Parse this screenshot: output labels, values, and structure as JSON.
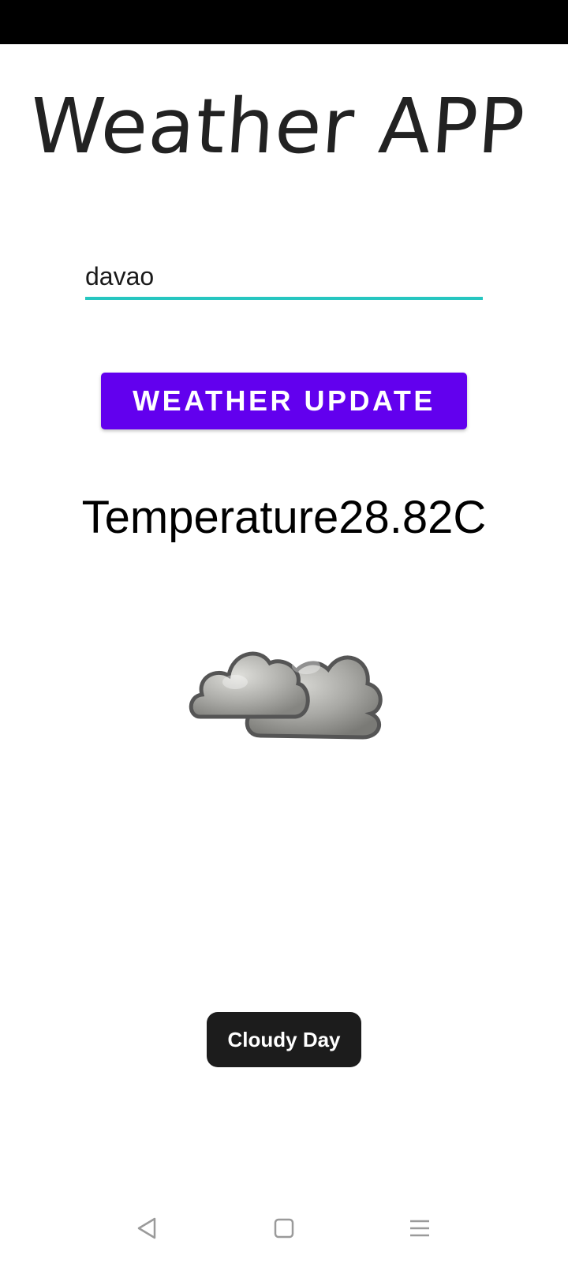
{
  "app": {
    "title": "Weather APP"
  },
  "search": {
    "value": "davao"
  },
  "actions": {
    "update_label": "WEATHER UPDATE"
  },
  "weather": {
    "temperature_text": "Temperature28.82C",
    "icon": "cloudy-icon"
  },
  "toast": {
    "message": "Cloudy Day"
  },
  "navigation": {
    "back_icon": "back-triangle-icon",
    "home_icon": "home-square-icon",
    "menu_icon": "menu-lines-icon"
  },
  "colors": {
    "accent": "#6200ee",
    "input_underline": "#26c6c0",
    "toast_bg": "#1c1c1c"
  }
}
